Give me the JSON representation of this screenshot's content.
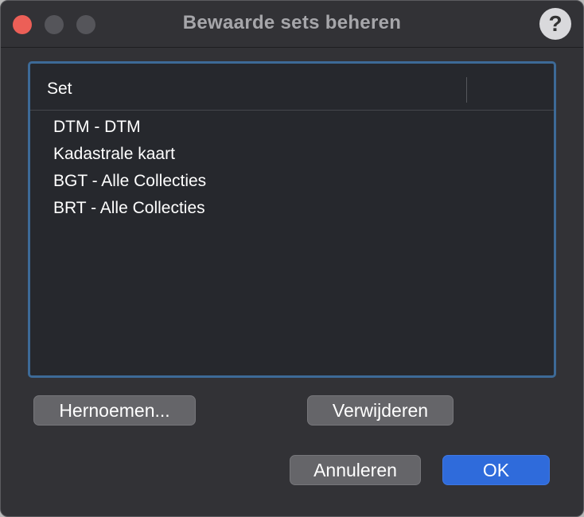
{
  "window": {
    "title": "Bewaarde sets beheren",
    "help_label": "?"
  },
  "table": {
    "column_header": "Set",
    "rows": [
      "DTM - DTM",
      "Kadastrale kaart",
      "BGT - Alle Collecties",
      "BRT - Alle Collecties"
    ]
  },
  "buttons": {
    "rename": "Hernoemen...",
    "delete": "Verwijderen",
    "cancel": "Annuleren",
    "ok": "OK"
  },
  "colors": {
    "close": "#ec5f57",
    "accent": "#2f6bdb",
    "selection_border": "#3d6a97"
  }
}
